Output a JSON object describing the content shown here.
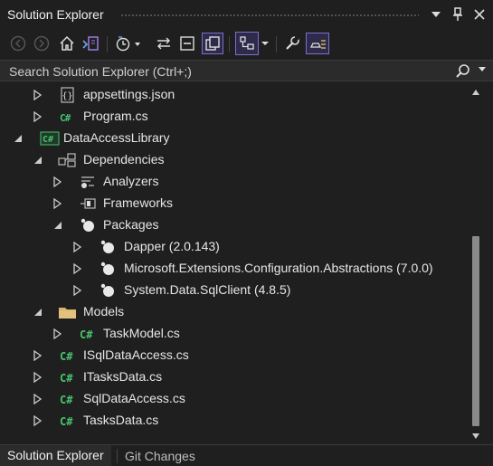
{
  "window": {
    "title": "Solution Explorer",
    "controls": [
      "dropdown-icon",
      "pin-icon",
      "close-icon"
    ]
  },
  "toolbar": {
    "buttons": [
      {
        "icon": "back-arrow-icon",
        "enabled": false
      },
      {
        "icon": "forward-arrow-icon",
        "enabled": false
      },
      {
        "icon": "home-icon",
        "enabled": true
      },
      {
        "icon": "switch-views-icon",
        "enabled": true
      },
      {
        "icon": "pending-changes-filter-icon",
        "enabled": true
      },
      {
        "icon": "sync-with-active-document-icon",
        "enabled": true
      },
      {
        "icon": "collapse-all-icon",
        "enabled": true
      },
      {
        "icon": "show-all-files-icon",
        "enabled": true,
        "selected": true
      },
      {
        "icon": "view-class-diagram-icon",
        "enabled": true,
        "selected": true
      },
      {
        "icon": "properties-wrench-icon",
        "enabled": true
      },
      {
        "icon": "preview-selected-items-icon",
        "enabled": true,
        "selected": true
      }
    ]
  },
  "search": {
    "placeholder": "Search Solution Explorer (Ctrl+;)"
  },
  "tree": [
    {
      "label": "appsettings.json",
      "icon": "json-file-icon",
      "level": 2,
      "expanded": false
    },
    {
      "label": "Program.cs",
      "icon": "csharp-file-icon",
      "level": 2,
      "expanded": false
    },
    {
      "label": "DataAccessLibrary",
      "icon": "csharp-project-icon",
      "level": 1,
      "expanded": true
    },
    {
      "label": "Dependencies",
      "icon": "dependencies-icon",
      "level": 2,
      "expanded": true
    },
    {
      "label": "Analyzers",
      "icon": "analyzers-icon",
      "level": 3,
      "expanded": false
    },
    {
      "label": "Frameworks",
      "icon": "frameworks-icon",
      "level": 3,
      "expanded": false
    },
    {
      "label": "Packages",
      "icon": "package-icon",
      "level": 3,
      "expanded": true
    },
    {
      "label": "Dapper (2.0.143)",
      "icon": "package-icon",
      "level": 4,
      "expanded": false
    },
    {
      "label": "Microsoft.Extensions.Configuration.Abstractions (7.0.0)",
      "icon": "package-icon",
      "level": 4,
      "expanded": false
    },
    {
      "label": "System.Data.SqlClient (4.8.5)",
      "icon": "package-icon",
      "level": 4,
      "expanded": false
    },
    {
      "label": "Models",
      "icon": "folder-icon",
      "level": 2,
      "expanded": true
    },
    {
      "label": "TaskModel.cs",
      "icon": "csharp-file-icon",
      "level": 3,
      "expanded": false
    },
    {
      "label": "ISqlDataAccess.cs",
      "icon": "csharp-file-icon",
      "level": 2,
      "expanded": false
    },
    {
      "label": "ITasksData.cs",
      "icon": "csharp-file-icon",
      "level": 2,
      "expanded": false
    },
    {
      "label": "SqlDataAccess.cs",
      "icon": "csharp-file-icon",
      "level": 2,
      "expanded": false
    },
    {
      "label": "TasksData.cs",
      "icon": "csharp-file-icon",
      "level": 2,
      "expanded": false
    }
  ],
  "bottom_tabs": [
    {
      "label": "Solution Explorer",
      "active": true
    },
    {
      "label": "Git Changes",
      "active": false
    }
  ],
  "colors": {
    "background": "#1f1f1f",
    "selected_border": "#7a6fd0",
    "csharp_green": "#46c46e",
    "folder_yellow": "#d8b56a"
  }
}
